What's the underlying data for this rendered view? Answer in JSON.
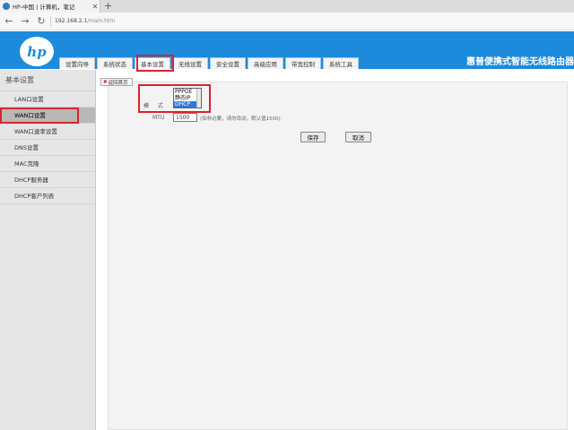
{
  "browser": {
    "tab_title": "HP-中国 | 计算机，笔记",
    "tab_close": "✕",
    "new_tab": "+",
    "back": "←",
    "forward": "→",
    "refresh": "↻",
    "url_host": "192.168.2.1",
    "url_path": "/main.htm"
  },
  "header": {
    "logo_text": "hp",
    "brand": "惠普便携式智能无线路由器"
  },
  "nav_tabs": [
    {
      "label": "设置向导"
    },
    {
      "label": "系统状态"
    },
    {
      "label": "基本设置",
      "active": true
    },
    {
      "label": "无线设置"
    },
    {
      "label": "安全设置"
    },
    {
      "label": "高级应用"
    },
    {
      "label": "带宽控制"
    },
    {
      "label": "系统工具"
    }
  ],
  "sidebar": {
    "title": "基本设置",
    "items": [
      {
        "label": "LAN口设置"
      },
      {
        "label": "WAN口设置",
        "active": true
      },
      {
        "label": "WAN口速率设置"
      },
      {
        "label": "DNS设置"
      },
      {
        "label": "MAC克隆"
      },
      {
        "label": "DHCP服务器"
      },
      {
        "label": "DHCP客户列表"
      }
    ]
  },
  "content": {
    "back_button": "返回首页",
    "mode_label": "模 式",
    "mode_options": [
      "PPPOE",
      "静态IP",
      "DHCP"
    ],
    "mode_selected": "DHCP",
    "mtu_label": "MTU",
    "mtu_value": "1500",
    "mtu_hint": "(如非必要，请勿改动，默认值1500)",
    "save_label": "保存",
    "cancel_label": "取消"
  },
  "colors": {
    "header_blue": "#1c8bdc",
    "highlight_red": "#d9242b",
    "selected_option": "#3178d6"
  }
}
